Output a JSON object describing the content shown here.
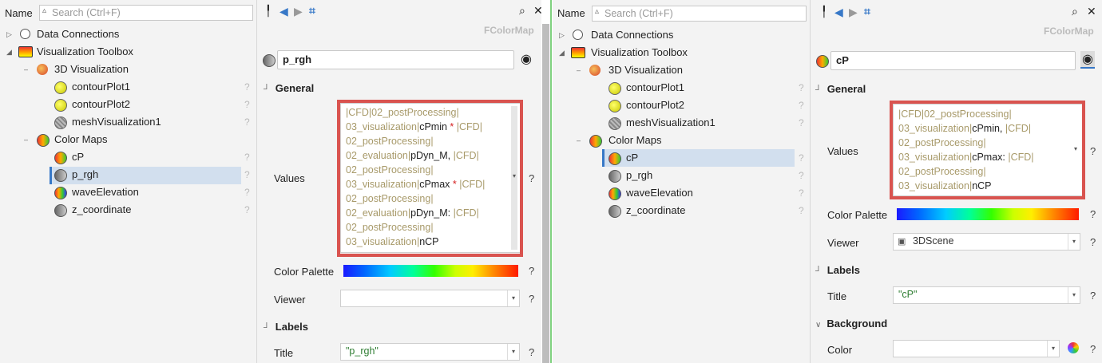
{
  "left": {
    "tree": {
      "name_label": "Name",
      "search_placeholder": "Search (Ctrl+F)",
      "items": [
        {
          "label": "Data Connections"
        },
        {
          "label": "Visualization Toolbox"
        },
        {
          "label": "3D Visualization"
        },
        {
          "label": "contourPlot1"
        },
        {
          "label": "contourPlot2"
        },
        {
          "label": "meshVisualization1"
        },
        {
          "label": "Color Maps"
        },
        {
          "label": "cP"
        },
        {
          "label": "p_rgh"
        },
        {
          "label": "waveElevation"
        },
        {
          "label": "z_coordinate"
        }
      ],
      "help": "?"
    },
    "props": {
      "type_label": "FColorMap",
      "object_name": "p_rgh",
      "section_general": "General",
      "values_label": "Values",
      "values_lines": [
        {
          "p": "|CFD|02_postProcessing|",
          "b": "",
          "s": "",
          "q": ""
        },
        {
          "p": "03_visualization|",
          "b": "cPmin",
          "s": " *",
          "q": " |CFD|"
        },
        {
          "p": "02_postProcessing|",
          "b": "",
          "s": "",
          "q": ""
        },
        {
          "p": "02_evaluation|",
          "b": "pDyn_M,",
          "s": "",
          "q": " |CFD|"
        },
        {
          "p": "02_postProcessing|",
          "b": "",
          "s": "",
          "q": ""
        },
        {
          "p": "03_visualization|",
          "b": "cPmax",
          "s": " *",
          "q": " |CFD|"
        },
        {
          "p": "02_postProcessing|",
          "b": "",
          "s": "",
          "q": ""
        },
        {
          "p": "02_evaluation|",
          "b": "pDyn_M:",
          "s": "",
          "q": " |CFD|"
        },
        {
          "p": "02_postProcessing|",
          "b": "",
          "s": "",
          "q": ""
        },
        {
          "p": "03_visualization|",
          "b": "nCP",
          "s": "",
          "q": ""
        }
      ],
      "color_palette_label": "Color Palette",
      "viewer_label": "Viewer",
      "viewer_value": "",
      "section_labels": "Labels",
      "title_label": "Title",
      "title_value": "\"p_rgh\"",
      "help": "?"
    }
  },
  "right": {
    "tree": {
      "name_label": "Name",
      "search_placeholder": "Search (Ctrl+F)",
      "items": [
        {
          "label": "Data Connections"
        },
        {
          "label": "Visualization Toolbox"
        },
        {
          "label": "3D Visualization"
        },
        {
          "label": "contourPlot1"
        },
        {
          "label": "contourPlot2"
        },
        {
          "label": "meshVisualization1"
        },
        {
          "label": "Color Maps"
        },
        {
          "label": "cP"
        },
        {
          "label": "p_rgh"
        },
        {
          "label": "waveElevation"
        },
        {
          "label": "z_coordinate"
        }
      ],
      "help": "?"
    },
    "props": {
      "type_label": "FColorMap",
      "object_name": "cP",
      "section_general": "General",
      "values_label": "Values",
      "values_lines": [
        {
          "p": "|CFD|02_postProcessing|",
          "b": "",
          "s": "",
          "q": ""
        },
        {
          "p": "03_visualization|",
          "b": "cPmin,",
          "s": "",
          "q": " |CFD|"
        },
        {
          "p": "02_postProcessing|",
          "b": "",
          "s": "",
          "q": ""
        },
        {
          "p": "03_visualization|",
          "b": "cPmax:",
          "s": "",
          "q": " |CFD|"
        },
        {
          "p": "02_postProcessing|",
          "b": "",
          "s": "",
          "q": ""
        },
        {
          "p": "03_visualization|",
          "b": "nCP",
          "s": "",
          "q": ""
        }
      ],
      "color_palette_label": "Color Palette",
      "viewer_label": "Viewer",
      "viewer_value": "3DScene",
      "section_labels": "Labels",
      "title_label": "Title",
      "title_value": "\"cP\"",
      "section_background": "Background",
      "color_label": "Color",
      "color_value": "",
      "help": "?"
    }
  },
  "colors": {
    "selection": "#d2dfee",
    "accent": "#3778c7",
    "highlight_box": "#d9534f",
    "path_text": "#a89a6a",
    "string_value": "#2e7d32"
  }
}
